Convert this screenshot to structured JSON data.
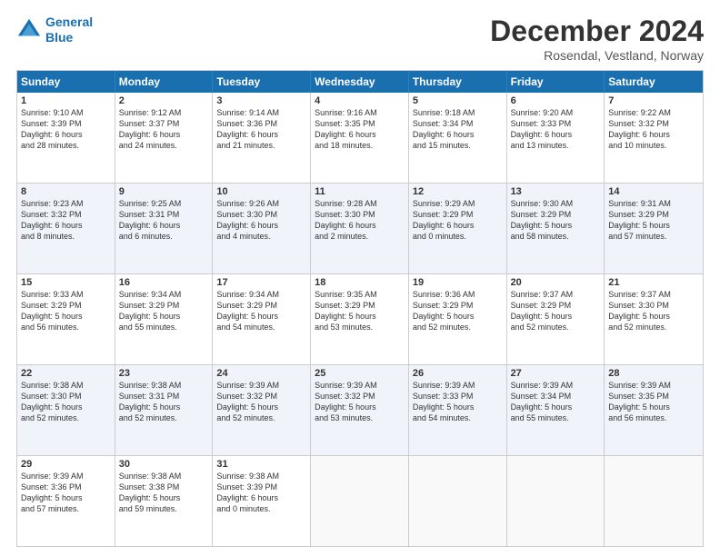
{
  "logo": {
    "line1": "General",
    "line2": "Blue"
  },
  "title": "December 2024",
  "subtitle": "Rosendal, Vestland, Norway",
  "header_days": [
    "Sunday",
    "Monday",
    "Tuesday",
    "Wednesday",
    "Thursday",
    "Friday",
    "Saturday"
  ],
  "rows": [
    [
      {
        "day": "1",
        "text": "Sunrise: 9:10 AM\nSunset: 3:39 PM\nDaylight: 6 hours\nand 28 minutes."
      },
      {
        "day": "2",
        "text": "Sunrise: 9:12 AM\nSunset: 3:37 PM\nDaylight: 6 hours\nand 24 minutes."
      },
      {
        "day": "3",
        "text": "Sunrise: 9:14 AM\nSunset: 3:36 PM\nDaylight: 6 hours\nand 21 minutes."
      },
      {
        "day": "4",
        "text": "Sunrise: 9:16 AM\nSunset: 3:35 PM\nDaylight: 6 hours\nand 18 minutes."
      },
      {
        "day": "5",
        "text": "Sunrise: 9:18 AM\nSunset: 3:34 PM\nDaylight: 6 hours\nand 15 minutes."
      },
      {
        "day": "6",
        "text": "Sunrise: 9:20 AM\nSunset: 3:33 PM\nDaylight: 6 hours\nand 13 minutes."
      },
      {
        "day": "7",
        "text": "Sunrise: 9:22 AM\nSunset: 3:32 PM\nDaylight: 6 hours\nand 10 minutes."
      }
    ],
    [
      {
        "day": "8",
        "text": "Sunrise: 9:23 AM\nSunset: 3:32 PM\nDaylight: 6 hours\nand 8 minutes."
      },
      {
        "day": "9",
        "text": "Sunrise: 9:25 AM\nSunset: 3:31 PM\nDaylight: 6 hours\nand 6 minutes."
      },
      {
        "day": "10",
        "text": "Sunrise: 9:26 AM\nSunset: 3:30 PM\nDaylight: 6 hours\nand 4 minutes."
      },
      {
        "day": "11",
        "text": "Sunrise: 9:28 AM\nSunset: 3:30 PM\nDaylight: 6 hours\nand 2 minutes."
      },
      {
        "day": "12",
        "text": "Sunrise: 9:29 AM\nSunset: 3:29 PM\nDaylight: 6 hours\nand 0 minutes."
      },
      {
        "day": "13",
        "text": "Sunrise: 9:30 AM\nSunset: 3:29 PM\nDaylight: 5 hours\nand 58 minutes."
      },
      {
        "day": "14",
        "text": "Sunrise: 9:31 AM\nSunset: 3:29 PM\nDaylight: 5 hours\nand 57 minutes."
      }
    ],
    [
      {
        "day": "15",
        "text": "Sunrise: 9:33 AM\nSunset: 3:29 PM\nDaylight: 5 hours\nand 56 minutes."
      },
      {
        "day": "16",
        "text": "Sunrise: 9:34 AM\nSunset: 3:29 PM\nDaylight: 5 hours\nand 55 minutes."
      },
      {
        "day": "17",
        "text": "Sunrise: 9:34 AM\nSunset: 3:29 PM\nDaylight: 5 hours\nand 54 minutes."
      },
      {
        "day": "18",
        "text": "Sunrise: 9:35 AM\nSunset: 3:29 PM\nDaylight: 5 hours\nand 53 minutes."
      },
      {
        "day": "19",
        "text": "Sunrise: 9:36 AM\nSunset: 3:29 PM\nDaylight: 5 hours\nand 52 minutes."
      },
      {
        "day": "20",
        "text": "Sunrise: 9:37 AM\nSunset: 3:29 PM\nDaylight: 5 hours\nand 52 minutes."
      },
      {
        "day": "21",
        "text": "Sunrise: 9:37 AM\nSunset: 3:30 PM\nDaylight: 5 hours\nand 52 minutes."
      }
    ],
    [
      {
        "day": "22",
        "text": "Sunrise: 9:38 AM\nSunset: 3:30 PM\nDaylight: 5 hours\nand 52 minutes."
      },
      {
        "day": "23",
        "text": "Sunrise: 9:38 AM\nSunset: 3:31 PM\nDaylight: 5 hours\nand 52 minutes."
      },
      {
        "day": "24",
        "text": "Sunrise: 9:39 AM\nSunset: 3:32 PM\nDaylight: 5 hours\nand 52 minutes."
      },
      {
        "day": "25",
        "text": "Sunrise: 9:39 AM\nSunset: 3:32 PM\nDaylight: 5 hours\nand 53 minutes."
      },
      {
        "day": "26",
        "text": "Sunrise: 9:39 AM\nSunset: 3:33 PM\nDaylight: 5 hours\nand 54 minutes."
      },
      {
        "day": "27",
        "text": "Sunrise: 9:39 AM\nSunset: 3:34 PM\nDaylight: 5 hours\nand 55 minutes."
      },
      {
        "day": "28",
        "text": "Sunrise: 9:39 AM\nSunset: 3:35 PM\nDaylight: 5 hours\nand 56 minutes."
      }
    ],
    [
      {
        "day": "29",
        "text": "Sunrise: 9:39 AM\nSunset: 3:36 PM\nDaylight: 5 hours\nand 57 minutes."
      },
      {
        "day": "30",
        "text": "Sunrise: 9:38 AM\nSunset: 3:38 PM\nDaylight: 5 hours\nand 59 minutes."
      },
      {
        "day": "31",
        "text": "Sunrise: 9:38 AM\nSunset: 3:39 PM\nDaylight: 6 hours\nand 0 minutes."
      },
      {
        "day": "",
        "text": ""
      },
      {
        "day": "",
        "text": ""
      },
      {
        "day": "",
        "text": ""
      },
      {
        "day": "",
        "text": ""
      }
    ]
  ]
}
